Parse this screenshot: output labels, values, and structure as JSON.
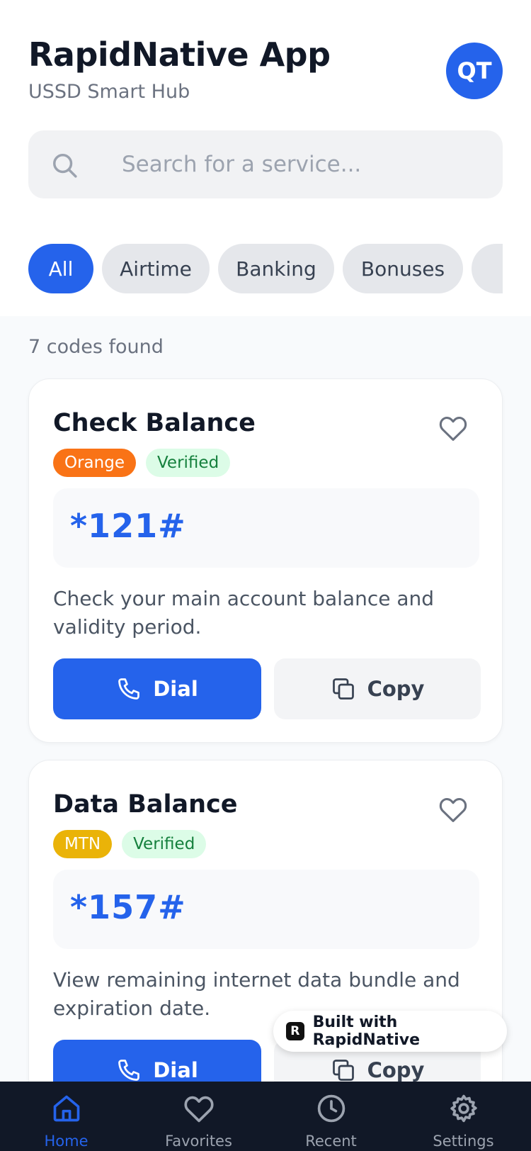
{
  "header": {
    "title": "RapidNative App",
    "subtitle": "USSD Smart Hub",
    "avatar_initials": "QT"
  },
  "search": {
    "placeholder": "Search for a service...",
    "value": ""
  },
  "filters": [
    "All",
    "Airtime",
    "Banking",
    "Bonuses"
  ],
  "results": {
    "count_text": "7 codes found"
  },
  "cards": [
    {
      "title": "Check Balance",
      "provider": "Orange",
      "status": "Verified",
      "code": "*121#",
      "description": "Check your main account balance and validity period.",
      "dial_label": "Dial",
      "copy_label": "Copy"
    },
    {
      "title": "Data Balance",
      "provider": "MTN",
      "status": "Verified",
      "code": "*157#",
      "description": "View remaining internet data bundle and expiration date.",
      "dial_label": "Dial",
      "copy_label": "Copy"
    }
  ],
  "badge": {
    "label": "Built with RapidNative"
  },
  "tabbar": {
    "home": "Home",
    "favorites": "Favorites",
    "recent": "Recent",
    "settings": "Settings"
  },
  "colors": {
    "primary": "#2563eb",
    "orange": "#f97316",
    "mtn": "#eab308",
    "verified_bg": "#dcfce7",
    "verified_text": "#15803d",
    "tabbar_bg": "#111827"
  }
}
